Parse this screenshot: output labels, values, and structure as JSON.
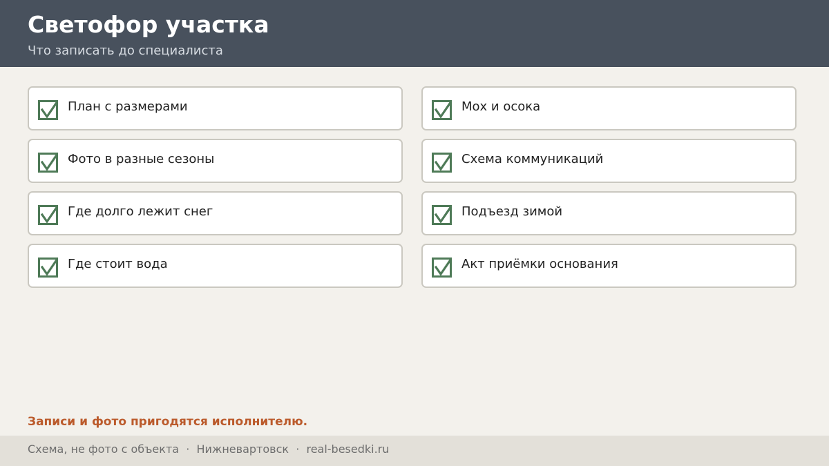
{
  "header": {
    "title": "Светофор участка",
    "subtitle": "Что записать до специалиста"
  },
  "checklist": {
    "left": [
      {
        "label": "План с размерами",
        "checked": true
      },
      {
        "label": "Фото в разные сезоны",
        "checked": true
      },
      {
        "label": "Где долго лежит снег",
        "checked": true
      },
      {
        "label": "Где стоит вода",
        "checked": true
      }
    ],
    "right": [
      {
        "label": "Мох и осока",
        "checked": true
      },
      {
        "label": "Схема коммуникаций",
        "checked": true
      },
      {
        "label": "Подъезд зимой",
        "checked": true
      },
      {
        "label": "Акт приёмки основания",
        "checked": true
      }
    ]
  },
  "note": "Записи и фото пригодятся исполнителю.",
  "footer": {
    "text": "Схема, не фото с объекта  ·  Нижневартовск  ·  real-besedki.ru"
  },
  "colors": {
    "header_bg": "#48515d",
    "page_bg": "#f3f1ec",
    "check_green": "#4e7a57",
    "note_accent": "#bb5a2b",
    "footer_bg": "#e3e0d9"
  },
  "icons": {
    "checkbox": "checkbox-checked-icon"
  }
}
